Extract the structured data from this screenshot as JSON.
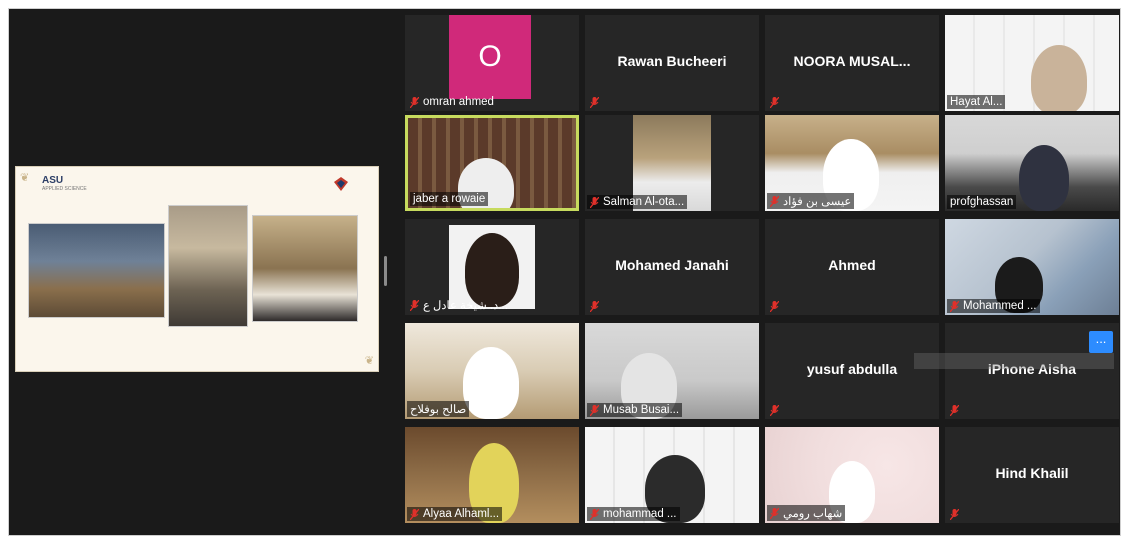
{
  "shared_screen": {
    "logo_text": "ASU",
    "logo_sub": "APPLIED SCIENCE"
  },
  "participants": [
    {
      "name": "omran ahmed",
      "center_name": "O",
      "type": "avatar",
      "muted": true
    },
    {
      "name": "",
      "center_name": "Rawan Bucheeri",
      "type": "name",
      "muted": true
    },
    {
      "name": "",
      "center_name": "NOORA  MUSAL...",
      "type": "name",
      "muted": true
    },
    {
      "name": "Hayat Al...",
      "center_name": "",
      "type": "video",
      "muted": false
    },
    {
      "name": "jaber a rowaie",
      "center_name": "",
      "type": "video",
      "muted": false,
      "active": true
    },
    {
      "name": "Salman Al-ota...",
      "center_name": "",
      "type": "video",
      "muted": true
    },
    {
      "name": "عيسى بن فؤاد",
      "center_name": "",
      "type": "video",
      "muted": true
    },
    {
      "name": "profghassan",
      "center_name": "",
      "type": "video",
      "muted": false
    },
    {
      "name": "د. شيخة عادل ع...",
      "center_name": "",
      "type": "video",
      "muted": true
    },
    {
      "name": "",
      "center_name": "Mohamed Janahi",
      "type": "name",
      "muted": true
    },
    {
      "name": "",
      "center_name": "Ahmed",
      "type": "name",
      "muted": true
    },
    {
      "name": "Mohammed ...",
      "center_name": "",
      "type": "video",
      "muted": true
    },
    {
      "name": "صالح بوفلاح",
      "center_name": "",
      "type": "video",
      "muted": false
    },
    {
      "name": "Musab Busai...",
      "center_name": "",
      "type": "video",
      "muted": true
    },
    {
      "name": "",
      "center_name": "yusuf abdulla",
      "type": "name",
      "muted": true
    },
    {
      "name": "",
      "center_name": "iPhone Aisha",
      "type": "name",
      "muted": true
    },
    {
      "name": "Alyaa Alhaml...",
      "center_name": "",
      "type": "video",
      "muted": true
    },
    {
      "name": "mohammad ...",
      "center_name": "",
      "type": "video",
      "muted": true
    },
    {
      "name": "شهاب رومي",
      "center_name": "",
      "type": "video",
      "muted": true
    },
    {
      "name": "",
      "center_name": "Hind Khalil",
      "type": "name",
      "muted": true
    }
  ],
  "more_button": "...",
  "colors": {
    "active_border": "#c7db5e",
    "mute": "#e0302a",
    "avatar": "#d0297a",
    "accent": "#2d8cff"
  }
}
